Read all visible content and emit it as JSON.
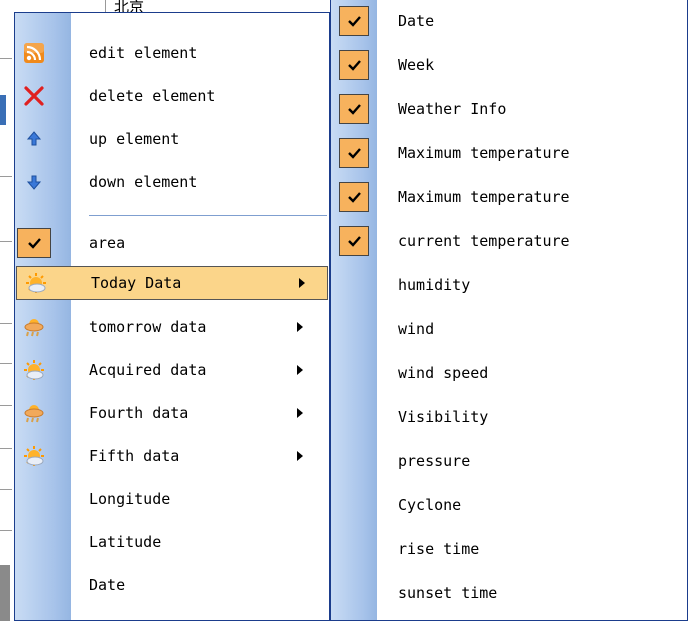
{
  "background": {
    "cell_text": "北京"
  },
  "context_menu": {
    "items": [
      {
        "label": "edit element",
        "icon": "rss-icon"
      },
      {
        "label": "delete element",
        "icon": "delete-icon"
      },
      {
        "label": "up element",
        "icon": "up-arrow-icon"
      },
      {
        "label": "down element",
        "icon": "down-arrow-icon"
      },
      {
        "label": "area",
        "icon": "checkmark-icon",
        "checked": true
      },
      {
        "label": "Today Data",
        "icon": "weather-sun-icon",
        "submenu": true,
        "highlighted": true
      },
      {
        "label": "tomorrow data",
        "icon": "weather-rain-icon",
        "submenu": true
      },
      {
        "label": "Acquired data",
        "icon": "weather-sun-icon",
        "submenu": true
      },
      {
        "label": "Fourth data",
        "icon": "weather-rain-icon",
        "submenu": true
      },
      {
        "label": "Fifth data",
        "icon": "weather-sun-icon",
        "submenu": true
      },
      {
        "label": "Longitude"
      },
      {
        "label": "Latitude"
      },
      {
        "label": "Date"
      }
    ]
  },
  "submenu": {
    "items": [
      {
        "label": "Date",
        "checked": true
      },
      {
        "label": "Week",
        "checked": true
      },
      {
        "label": "Weather Info",
        "checked": true
      },
      {
        "label": "Maximum temperature",
        "checked": true
      },
      {
        "label": "Maximum temperature",
        "checked": true
      },
      {
        "label": "current temperature",
        "checked": true
      },
      {
        "label": "humidity"
      },
      {
        "label": "wind"
      },
      {
        "label": "wind speed"
      },
      {
        "label": "Visibility"
      },
      {
        "label": "pressure"
      },
      {
        "label": "Cyclone"
      },
      {
        "label": "rise time"
      },
      {
        "label": "sunset time"
      }
    ]
  },
  "colors": {
    "gutter": "#a7c3ea",
    "highlight": "#fbd58a",
    "check_bg": "#f7b25d",
    "border": "#1b3d8c"
  }
}
